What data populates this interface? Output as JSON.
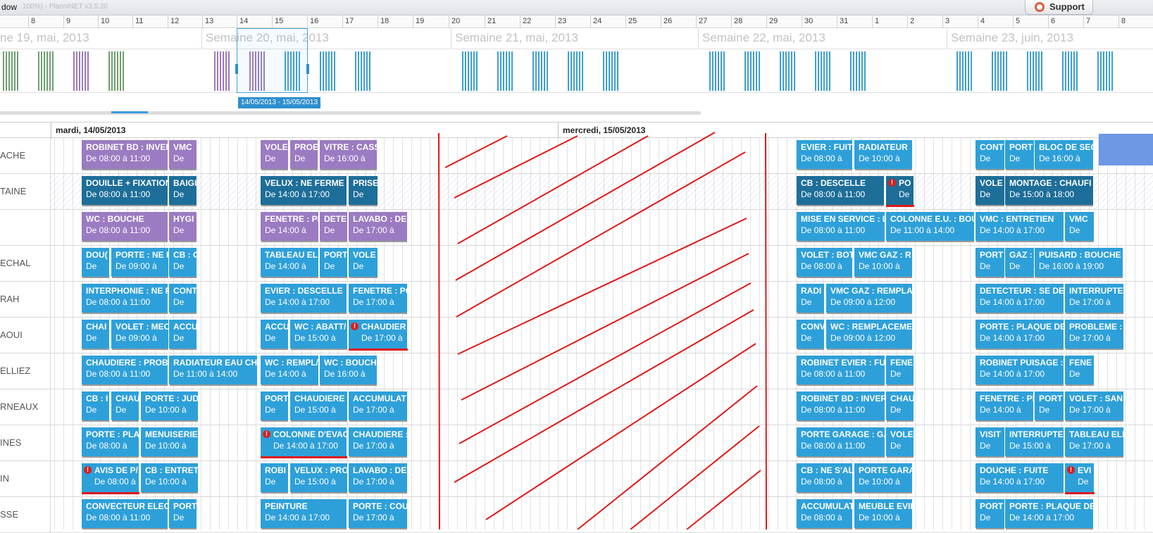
{
  "window": {
    "title": "dow",
    "title_dim": "100%) - PlanniNET v3.5.20",
    "support_label": "Support"
  },
  "day_ruler": [
    "8",
    "9",
    "10",
    "11",
    "12",
    "13",
    "14",
    "15",
    "16",
    "17",
    "18",
    "19",
    "20",
    "21",
    "22",
    "23",
    "24",
    "25",
    "26",
    "27",
    "28",
    "29",
    "30",
    "31",
    "1",
    "2",
    "3",
    "4",
    "5",
    "6",
    "7",
    "8"
  ],
  "weeks": [
    "ne 19, mai, 2013",
    "Semaine 20, mai, 2013",
    "Semaine 21, mai, 2013",
    "Semaine 22, mai, 2013",
    "Semaine 23, juin, 2013"
  ],
  "selection_label": "14/05/2013 - 15/05/2013",
  "dates": [
    "mardi, 14/05/2013",
    "mercredi, 15/05/2013"
  ],
  "rows": [
    "ACHE",
    "TAINE",
    "",
    "ECHAL",
    "RAH",
    "AOUI",
    "ELLIEZ",
    "RNEAUX",
    "INES",
    "IN",
    "SSE"
  ],
  "appointments": [
    [
      {
        "t": "ROBINET BD : INVER",
        "h": "De 08:00 à 11:00",
        "c": "violet"
      },
      {
        "t": "VMC",
        "h": "De",
        "c": "violet"
      },
      {
        "t": "VOLE",
        "h": "De",
        "c": "violet"
      },
      {
        "t": "PROE",
        "h": "De",
        "c": "violet"
      },
      {
        "t": "VITRE : CASS",
        "h": "De 16:00 à",
        "c": "violet"
      },
      {
        "t": "EVIER : FUITE",
        "h": "De 08:00 à",
        "c": "blue"
      },
      {
        "t": "RADIATEUR",
        "h": "De 10:00 à",
        "c": "blue"
      },
      {
        "t": "CONT",
        "h": "De",
        "c": "blue"
      },
      {
        "t": "PORT",
        "h": "De",
        "c": "blue"
      },
      {
        "t": "BLOC DE SEC",
        "h": "De 16:00 à",
        "c": "blue"
      }
    ],
    [
      {
        "t": "DOUILLE + FIXATION",
        "h": "De 08:00 à 11:00",
        "c": "dark"
      },
      {
        "t": "BAIGI",
        "h": "De",
        "c": "dark"
      },
      {
        "t": "VELUX : NE FERME P",
        "h": "De 14:00 à 17:00",
        "c": "dark"
      },
      {
        "t": "PRISE",
        "h": "De",
        "c": "dark"
      },
      {
        "t": "CB : DESCELLE",
        "h": "De 08:00 à 11:00",
        "c": "dark"
      },
      {
        "t": "PO",
        "h": "De",
        "c": "dark",
        "alert": true
      },
      {
        "t": "VOLE",
        "h": "De",
        "c": "dark"
      },
      {
        "t": "MONTAGE : CHAUFI",
        "h": "De 15:00 à 18:00",
        "c": "dark"
      }
    ],
    [
      {
        "t": "WC : BOUCHE",
        "h": "De 08:00 à 11:00",
        "c": "violet"
      },
      {
        "t": "HYGI",
        "h": "De",
        "c": "violet"
      },
      {
        "t": "FENETRE : PF",
        "h": "De 14:00 à",
        "c": "violet"
      },
      {
        "t": "DETE",
        "h": "De",
        "c": "violet"
      },
      {
        "t": "LAVABO : DE",
        "h": "De 17:00 à",
        "c": "violet"
      },
      {
        "t": "MISE EN SERVICE : L",
        "h": "De 08:00 à 11:00",
        "c": "blue"
      },
      {
        "t": "COLONNE E.U. : BOU",
        "h": "De 11:00 à 14:00",
        "c": "blue"
      },
      {
        "t": "VMC : ENTRETIEN",
        "h": "De 14:00 à 17:00",
        "c": "blue"
      },
      {
        "t": "VMC",
        "h": "De",
        "c": "blue"
      }
    ],
    [
      {
        "t": "DOU(",
        "h": "De",
        "c": "blue"
      },
      {
        "t": "PORTE : NE F",
        "h": "De 09:00 à",
        "c": "blue"
      },
      {
        "t": "CB : C",
        "h": "De",
        "c": "blue"
      },
      {
        "t": "TABLEAU ELI",
        "h": "De 14:00 à",
        "c": "blue"
      },
      {
        "t": "PORT",
        "h": "De",
        "c": "blue"
      },
      {
        "t": "VOLE",
        "h": "De",
        "c": "blue"
      },
      {
        "t": "VOLET : BOTI",
        "h": "De 08:00 à",
        "c": "blue"
      },
      {
        "t": "VMC GAZ : R",
        "h": "De 10:00 à",
        "c": "blue"
      },
      {
        "t": "PORT",
        "h": "De",
        "c": "blue"
      },
      {
        "t": "GAZ :",
        "h": "De",
        "c": "blue"
      },
      {
        "t": "PUISARD : BOUCHE",
        "h": "De 16:00 à 19:00",
        "c": "blue"
      }
    ],
    [
      {
        "t": "INTERPHONIE : NE F",
        "h": "De 08:00 à 11:00",
        "c": "blue"
      },
      {
        "t": "CONT",
        "h": "De",
        "c": "blue"
      },
      {
        "t": "EVIER : DESCELLE",
        "h": "De 14:00 à 17:00",
        "c": "blue"
      },
      {
        "t": "FENETRE : PC",
        "h": "De 17:00 à",
        "c": "blue"
      },
      {
        "t": "RADI",
        "h": "De",
        "c": "blue"
      },
      {
        "t": "VMC GAZ : REMPLA(",
        "h": "De 09:00 à 12:00",
        "c": "blue"
      },
      {
        "t": "DETECTEUR : SE DEC",
        "h": "De 14:00 à 17:00",
        "c": "blue"
      },
      {
        "t": "INTERRUPTE",
        "h": "De 17:00 à",
        "c": "blue"
      }
    ],
    [
      {
        "t": "CHAI",
        "h": "De",
        "c": "blue"
      },
      {
        "t": "VOLET : MEC",
        "h": "De 09:00 à",
        "c": "blue"
      },
      {
        "t": "ACCU",
        "h": "De",
        "c": "blue"
      },
      {
        "t": "ACCU",
        "h": "De",
        "c": "blue"
      },
      {
        "t": "WC : ABATT/",
        "h": "De 15:00 à",
        "c": "blue"
      },
      {
        "t": "CHAUDIER",
        "h": "De 17:00 à",
        "c": "blue",
        "alert": true
      },
      {
        "t": "CONV",
        "h": "De",
        "c": "blue"
      },
      {
        "t": "WC : REMPLACEMEN",
        "h": "De 09:00 à 12:00",
        "c": "blue"
      },
      {
        "t": "PORTE : PLAQUE DE",
        "h": "De 14:00 à 17:00",
        "c": "blue"
      },
      {
        "t": "PROBLEME :",
        "h": "De 17:00 à",
        "c": "blue"
      }
    ],
    [
      {
        "t": "CHAUDIERE : PROBL",
        "h": "De 08:00 à 11:00",
        "c": "blue"
      },
      {
        "t": "RADIATEUR EAU CH",
        "h": "De 11:00 à 14:00",
        "c": "blue"
      },
      {
        "t": "WC : REMPL/",
        "h": "De 14:00 à",
        "c": "blue"
      },
      {
        "t": "WC : BOUCH",
        "h": "De 16:00 à",
        "c": "blue"
      },
      {
        "t": "ROBINET EVIER : FUI",
        "h": "De 08:00 à 11:00",
        "c": "blue"
      },
      {
        "t": "FENE",
        "h": "De",
        "c": "blue"
      },
      {
        "t": "ROBINET PUISAGE :",
        "h": "De 14:00 à 17:00",
        "c": "blue"
      },
      {
        "t": "FENE",
        "h": "De",
        "c": "blue"
      }
    ],
    [
      {
        "t": "CB : I",
        "h": "De",
        "c": "blue"
      },
      {
        "t": "CHAU",
        "h": "De",
        "c": "blue"
      },
      {
        "t": "PORTE : JUD.",
        "h": "De 10:00 à",
        "c": "blue"
      },
      {
        "t": "PORT",
        "h": "De",
        "c": "blue"
      },
      {
        "t": "CHAUDIERE",
        "h": "De 15:00 à",
        "c": "blue"
      },
      {
        "t": "ACCUMULAT",
        "h": "De 17:00 à",
        "c": "blue"
      },
      {
        "t": "ROBINET BD : INVER",
        "h": "De 08:00 à 11:00",
        "c": "blue"
      },
      {
        "t": "CHAU",
        "h": "De",
        "c": "blue"
      },
      {
        "t": "FENETRE : PF",
        "h": "De 14:00 à",
        "c": "blue"
      },
      {
        "t": "PORT",
        "h": "De",
        "c": "blue"
      },
      {
        "t": "VOLET : SAN",
        "h": "De 17:00 à",
        "c": "blue"
      }
    ],
    [
      {
        "t": "PORTE : PLA(",
        "h": "De 08:00 à",
        "c": "blue"
      },
      {
        "t": "MENUISERIE",
        "h": "De 10:00 à",
        "c": "blue"
      },
      {
        "t": "COLONNE D'EVAC",
        "h": "De 14:00 à 17:00",
        "c": "blue",
        "alert": true
      },
      {
        "t": "CHAUDIERE :",
        "h": "De 17:00 à",
        "c": "blue"
      },
      {
        "t": "PORTE GARAGE : GA",
        "h": "De 08:00 à 11:00",
        "c": "blue"
      },
      {
        "t": "VOLE",
        "h": "De",
        "c": "blue"
      },
      {
        "t": "VISIT",
        "h": "De",
        "c": "blue"
      },
      {
        "t": "INTERRUPTE",
        "h": "De 15:00 à",
        "c": "blue"
      },
      {
        "t": "TABLEAU ELI",
        "h": "De 17:00 à",
        "c": "blue"
      }
    ],
    [
      {
        "t": "AVIS DE P/",
        "h": "De 08:00 à",
        "c": "blue",
        "alert": true
      },
      {
        "t": "CB : ENTRETI",
        "h": "De 10:00 à",
        "c": "blue"
      },
      {
        "t": "ROBI",
        "h": "De",
        "c": "blue"
      },
      {
        "t": "VELUX : PRO",
        "h": "De 15:00 à",
        "c": "blue"
      },
      {
        "t": "LAVABO : DE",
        "h": "De 17:00 à",
        "c": "blue"
      },
      {
        "t": "CB : NE S'ALI",
        "h": "De 08:00 à",
        "c": "blue"
      },
      {
        "t": "PORTE GARA",
        "h": "De 10:00 à",
        "c": "blue"
      },
      {
        "t": "DOUCHE : FUITE",
        "h": "De 14:00 à 17:00",
        "c": "blue"
      },
      {
        "t": "EVI",
        "h": "De",
        "c": "blue",
        "alert": true
      }
    ],
    [
      {
        "t": "CONVECTEUR ELECT",
        "h": "De 08:00 à 11:00",
        "c": "blue"
      },
      {
        "t": "PORT",
        "h": "De",
        "c": "blue"
      },
      {
        "t": "PEINTURE",
        "h": "De 14:00 à 17:00",
        "c": "blue"
      },
      {
        "t": "PORTE : COU",
        "h": "De 17:00 à",
        "c": "blue"
      },
      {
        "t": "ACCUMULAT",
        "h": "De 08:00 à",
        "c": "blue"
      },
      {
        "t": "MEUBLE EVII",
        "h": "De 10:00 à",
        "c": "blue"
      },
      {
        "t": "PORT",
        "h": "De",
        "c": "blue"
      },
      {
        "t": "PORTE : PLAQUE DE",
        "h": "De 14:00 à 17:00",
        "c": "blue"
      }
    ]
  ],
  "colors": {
    "blue": "#2ea0d9",
    "violet": "#9b7bc1",
    "dark": "#1d6e99",
    "annotation": "#e01818"
  }
}
